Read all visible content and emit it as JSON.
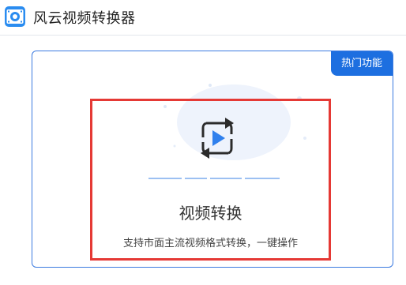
{
  "app": {
    "title": "风云视频转换器",
    "icon": "video-app-icon",
    "accent_color": "#1d6fe0"
  },
  "card": {
    "badge_label": "热门功能",
    "feature_icon": "video-convert-icon",
    "feature_title": "视频转换",
    "feature_description": "支持市面主流视频格式转换，一键操作",
    "highlight_color": "#e53935"
  }
}
